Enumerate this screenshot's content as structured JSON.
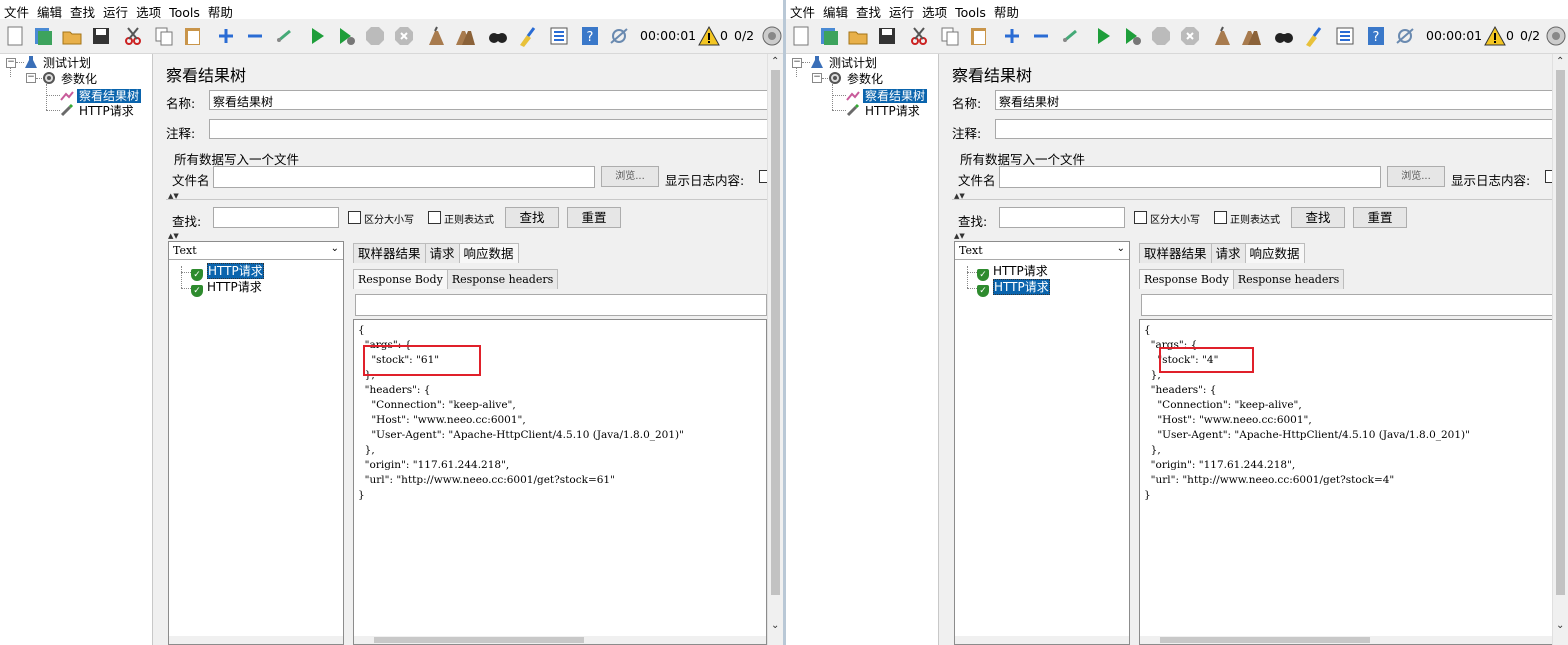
{
  "menu": [
    "文件",
    "编辑",
    "查找",
    "运行",
    "选项",
    "Tools",
    "帮助"
  ],
  "toolbar": {
    "timer": "00:00:01",
    "warn_count": "0",
    "threads": "0/2",
    "icons": [
      "new-icon",
      "templates-icon",
      "open-icon",
      "save-icon",
      "cut-icon",
      "copy-icon",
      "paste-icon",
      "expand-icon",
      "collapse-icon",
      "toggle-icon",
      "start-icon",
      "start-no-pause-icon",
      "stop-icon",
      "shutdown-icon",
      "clear-icon",
      "clear-all-icon",
      "search-icon",
      "reset-search-icon",
      "function-helper-icon",
      "help-icon",
      "remote-icon"
    ]
  },
  "windows": [
    {
      "tree": {
        "plan": "测试计划",
        "param": "参数化",
        "listener": "察看结果树",
        "sampler": "HTTP请求"
      },
      "panel": {
        "title": "察看结果树",
        "name_label": "名称:",
        "name_value": "察看结果树",
        "comment_label": "注释:",
        "comment_value": "",
        "file_section": "所有数据写入一个文件",
        "filename_label": "文件名",
        "filename_value": "",
        "browse": "浏览...",
        "log_label": "显示日志内容:",
        "search_label": "查找:",
        "search_value": "",
        "case_label": "区分大小写",
        "regex_label": "正则表达式",
        "find_btn": "查找",
        "reset_btn": "重置"
      },
      "results": {
        "renderer": "Text",
        "items": [
          "HTTP请求",
          "HTTP请求"
        ],
        "selected": 0,
        "tabs": [
          "取样器结果",
          "请求",
          "响应数据"
        ],
        "subtabs": [
          "Response Body",
          "Response headers"
        ],
        "body": "{\n  \"args\": {\n    \"stock\": \"61\"\n  },\n  \"headers\": {\n    \"Connection\": \"keep-alive\",\n    \"Host\": \"www.neeo.cc:6001\",\n    \"User-Agent\": \"Apache-HttpClient/4.5.10 (Java/1.8.0_201)\"\n  },\n  \"origin\": \"117.61.244.218\",\n  \"url\": \"http://www.neeo.cc:6001/get?stock=61\"\n}"
      }
    },
    {
      "tree": {
        "plan": "测试计划",
        "param": "参数化",
        "listener": "察看结果树",
        "sampler": "HTTP请求"
      },
      "panel": {
        "title": "察看结果树",
        "name_label": "名称:",
        "name_value": "察看结果树",
        "comment_label": "注释:",
        "comment_value": "",
        "file_section": "所有数据写入一个文件",
        "filename_label": "文件名",
        "filename_value": "",
        "browse": "浏览...",
        "log_label": "显示日志内容:",
        "search_label": "查找:",
        "search_value": "",
        "case_label": "区分大小写",
        "regex_label": "正则表达式",
        "find_btn": "查找",
        "reset_btn": "重置"
      },
      "results": {
        "renderer": "Text",
        "items": [
          "HTTP请求",
          "HTTP请求"
        ],
        "selected": 1,
        "tabs": [
          "取样器结果",
          "请求",
          "响应数据"
        ],
        "subtabs": [
          "Response Body",
          "Response headers"
        ],
        "body": "{\n  \"args\": {\n    \"stock\": \"4\"\n  },\n  \"headers\": {\n    \"Connection\": \"keep-alive\",\n    \"Host\": \"www.neeo.cc:6001\",\n    \"User-Agent\": \"Apache-HttpClient/4.5.10 (Java/1.8.0_201)\"\n  },\n  \"origin\": \"117.61.244.218\",\n  \"url\": \"http://www.neeo.cc:6001/get?stock=4\"\n}"
      }
    }
  ],
  "colors": {
    "selection": "#0a64ad",
    "highlight_box": "#e0202a",
    "success": "#2e8b2e"
  }
}
